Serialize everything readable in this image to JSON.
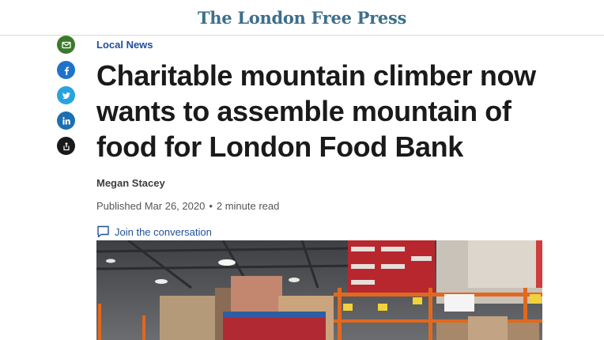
{
  "header": {
    "masthead": "The London Free Press"
  },
  "share": [
    {
      "icon": "email-icon",
      "color": "#3c7a2b"
    },
    {
      "icon": "facebook-icon",
      "color": "#1e73c9"
    },
    {
      "icon": "twitter-icon",
      "color": "#29a3e0"
    },
    {
      "icon": "linkedin-icon",
      "color": "#1c6fb1"
    },
    {
      "icon": "share-icon",
      "color": "#1a1a1a"
    }
  ],
  "article": {
    "section": "Local News",
    "headline": "Charitable mountain climber now wants to assemble mountain of food for London Food Bank",
    "author": "Megan Stacey",
    "published": "Published Mar 26, 2020",
    "separator": "•",
    "read_time": "2 minute read",
    "conversation": "Join the conversation"
  },
  "image": {
    "alt": "Warehouse shelves stacked with pallets of food",
    "icon": "photo-image"
  }
}
